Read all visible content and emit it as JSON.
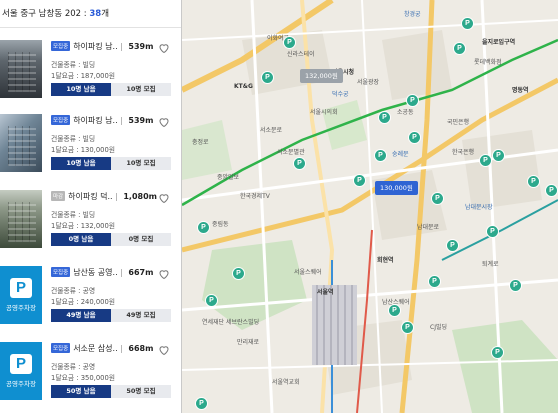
{
  "header": {
    "location": "서울 중구 남창동 202 : ",
    "count": "38",
    "count_suffix": "개"
  },
  "lots": [
    {
      "badge": "모집중",
      "name": "하이파킹 남..",
      "distance": "539m",
      "type_text": "건물종류 : 빌딩",
      "fee_text": "1달요금 : 187,000원",
      "remaining": "10명 남음",
      "recruit": "10명 모집"
    },
    {
      "badge": "모집중",
      "name": "하이파킹 남..",
      "distance": "539m",
      "type_text": "건물종류 : 빌딩",
      "fee_text": "1달요금 : 130,000원",
      "remaining": "10명 남음",
      "recruit": "10명 모집"
    },
    {
      "badge": "마감",
      "name": "하이파킹 덕..",
      "distance": "1,080m",
      "type_text": "건물종류 : 빌딩",
      "fee_text": "1달요금 : 132,000원",
      "remaining": "0명 남음",
      "recruit": "0명 모집"
    },
    {
      "badge": "모집중",
      "name": "남산동 공영..",
      "distance": "667m",
      "type_text": "건물종류 : 공영",
      "fee_text": "1달요금 : 240,000원",
      "remaining": "49명 남음",
      "recruit": "49명 모집",
      "thumb_label": "공영주차장"
    },
    {
      "badge": "모집중",
      "name": "서소문 삼성..",
      "distance": "668m",
      "type_text": "건물종류 : 공영",
      "fee_text": "1달요금 : 350,000원",
      "remaining": "50명 남음",
      "recruit": "50명 모집",
      "thumb_label": "공영주차장"
    }
  ],
  "map": {
    "price_tags": [
      "132,000원",
      "130,000원"
    ],
    "pin_glyph": "P",
    "labels": [
      "KT&G",
      "신라스테이",
      "창경궁",
      "서울시의회",
      "덕수궁",
      "서울시청",
      "서울광장",
      "서소문별관",
      "한국경제TV",
      "서울역",
      "숭례문",
      "남대문시장",
      "명동역",
      "회현역",
      "남산스퀘어",
      "서울스퀘어",
      "CJ빌딩",
      "국민은행",
      "중앙일보",
      "을지로입구역",
      "한국은행",
      "연세재단 세브란스빌딩",
      "남대문로",
      "이화여고",
      "중림동",
      "만리재로",
      "소공동",
      "충정로",
      "서울역교회",
      "롯데백화점",
      "서소문로",
      "퇴계로"
    ]
  },
  "colors": {
    "accent": "#3567d8",
    "navy": "#173a84",
    "public": "#0f8fd0",
    "pin": "#2ca98c"
  }
}
